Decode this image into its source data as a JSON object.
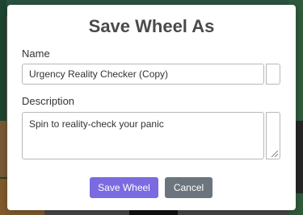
{
  "dialog": {
    "title": "Save Wheel As",
    "name_label": "Name",
    "name_value": "Urgency Reality Checker (Copy)",
    "description_label": "Description",
    "description_value": "Spin to reality-check your panic",
    "save_label": "Save Wheel",
    "cancel_label": "Cancel"
  },
  "colors": {
    "save_button": "#7b6be0",
    "cancel_button": "#6c757d"
  }
}
